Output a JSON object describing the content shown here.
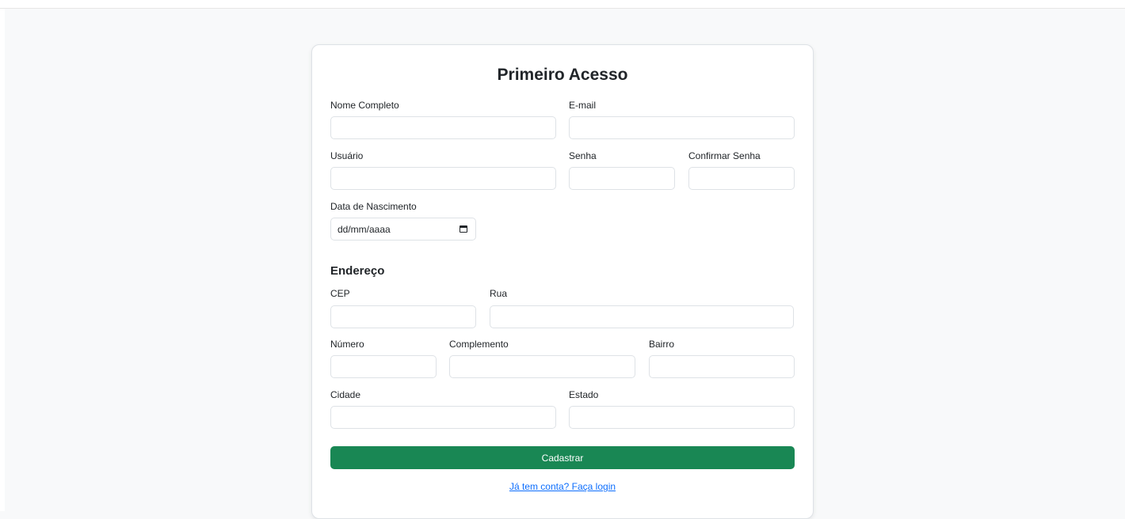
{
  "form": {
    "title": "Primeiro Acesso",
    "fields": {
      "nome_completo": {
        "label": "Nome Completo",
        "value": ""
      },
      "email": {
        "label": "E-mail",
        "value": ""
      },
      "usuario": {
        "label": "Usuário",
        "value": ""
      },
      "senha": {
        "label": "Senha",
        "value": ""
      },
      "confirmar_senha": {
        "label": "Confirmar Senha",
        "value": ""
      },
      "data_nascimento": {
        "label": "Data de Nascimento",
        "placeholder": "dd/mm/aaaa",
        "icon": "calendar-icon"
      }
    },
    "address": {
      "heading": "Endereço",
      "cep": {
        "label": "CEP",
        "value": ""
      },
      "rua": {
        "label": "Rua",
        "value": ""
      },
      "numero": {
        "label": "Número",
        "value": ""
      },
      "complemento": {
        "label": "Complemento",
        "value": ""
      },
      "bairro": {
        "label": "Bairro",
        "value": ""
      },
      "cidade": {
        "label": "Cidade",
        "value": ""
      },
      "estado": {
        "label": "Estado",
        "value": ""
      }
    },
    "submit_label": "Cadastrar",
    "login_link": "Já tem conta? Faça login"
  },
  "colors": {
    "accent": "#198754",
    "link": "#0d6efd",
    "background": "#f8f9fa"
  }
}
